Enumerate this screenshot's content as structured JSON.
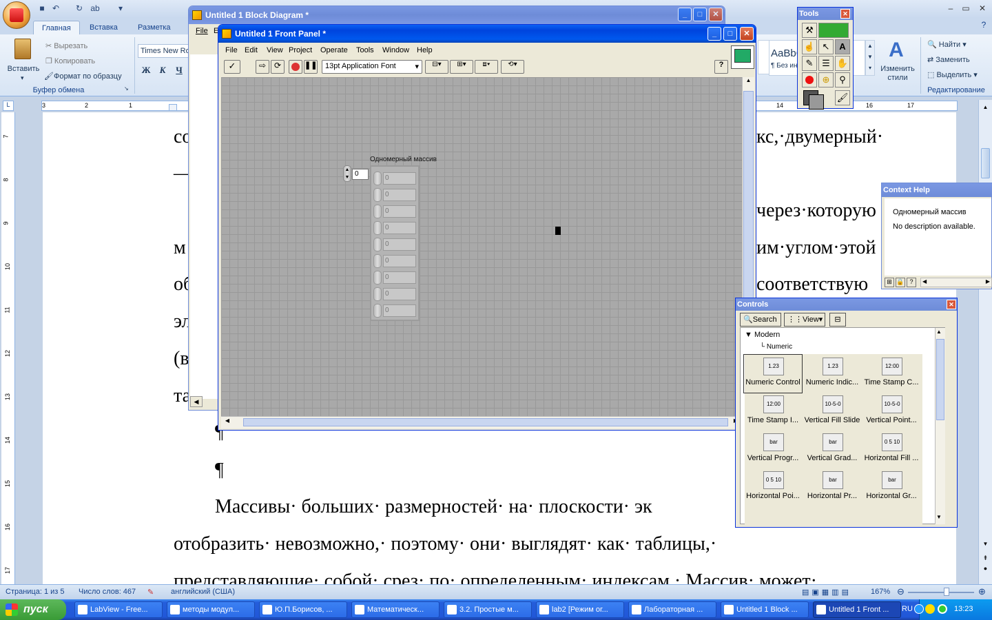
{
  "word": {
    "ribbon_tabs": [
      "Главная",
      "Вставка",
      "Разметка стра"
    ],
    "clipboard": {
      "paste": "Вставить",
      "cut": "Вырезать",
      "copy": "Копировать",
      "format_painter": "Формат по образцу",
      "group_label": "Буфер обмена"
    },
    "font_name": "Times New Ro",
    "bold": "Ж",
    "italic": "К",
    "underline": "Ч",
    "styles": {
      "sample": "AaBbC",
      "normal_label": "¶ Без ин",
      "change_styles": "Изменить стили"
    },
    "editing": {
      "find": "Найти",
      "replace": "Заменить",
      "select": "Выделить",
      "group_label": "Редактирование"
    },
    "ruler_left": [
      "3",
      "2",
      "1",
      "1"
    ],
    "ruler_right": [
      "14",
      "16",
      "17"
    ],
    "vruler": [
      "7",
      "8",
      "9",
      "10",
      "11",
      "12",
      "13",
      "14",
      "15",
      "16",
      "17"
    ],
    "doc_lines": [
      {
        "text": "со"
      },
      {
        "text": "кс,·двумерный·"
      },
      {
        "text": "—·"
      },
      {
        "text": "через·которую"
      },
      {
        "text": "м"
      },
      {
        "text": "им·углом·этой"
      },
      {
        "text": "об"
      },
      {
        "text": "соответствую"
      },
      {
        "text": "эл"
      },
      {
        "text": "(в"
      },
      {
        "text": "та"
      },
      {
        "text": "¶"
      },
      {
        "text": "¶"
      },
      {
        "text": "Массивы· больших· размерностей· на· плоскости· эк"
      },
      {
        "text": "отобразить·     невозможно,·     поэтому·     они·     выглядят·     как·     таблицы,·"
      },
      {
        "text": "представляющие· собой· срез· по· определенным· индексам.· Массив· может·"
      }
    ],
    "status": {
      "page": "Страница: 1 из 5",
      "words": "Число слов: 467",
      "language": "английский (США)",
      "zoom": "167%"
    }
  },
  "taskbar": {
    "start": "пуск",
    "items": [
      "LabView - Free...",
      "методы модул...",
      "Ю.П.Борисов, ...",
      "Математическ...",
      "3.2. Простые м...",
      "lab2 [Режим ог...",
      "Лабораторная ...",
      "Untitled 1 Block ...",
      "Untitled 1 Front ..."
    ],
    "lang": "RU",
    "clock": "13:23"
  },
  "block_diagram": {
    "title": "Untitled 1 Block Diagram *",
    "menu_first": "File",
    "menu_second": "E"
  },
  "front_panel": {
    "title": "Untitled 1 Front Panel *",
    "menu": [
      "File",
      "Edit",
      "View",
      "Project",
      "Operate",
      "Tools",
      "Window",
      "Help"
    ],
    "font_selector": "13pt Application Font",
    "array_label": "Одномерный массив",
    "index_value": "0",
    "elements": [
      "0",
      "0",
      "0",
      "0",
      "0",
      "0",
      "0",
      "0",
      "0"
    ]
  },
  "tools_palette": {
    "title": "Tools"
  },
  "context_help": {
    "title": "Context Help",
    "name": "Одномерный массив",
    "description": "No description available."
  },
  "controls_palette": {
    "title": "Controls",
    "search": "Search",
    "view": "View",
    "tree_root": "Modern",
    "tree_child": "Numeric",
    "items": [
      {
        "label": "Numeric Control",
        "icon": "1.23"
      },
      {
        "label": "Numeric Indic...",
        "icon": "1.23"
      },
      {
        "label": "Time Stamp C...",
        "icon": "12:00"
      },
      {
        "label": "Time Stamp I...",
        "icon": "12:00"
      },
      {
        "label": "Vertical Fill Slide",
        "icon": "10-5-0"
      },
      {
        "label": "Vertical Point...",
        "icon": "10-5-0"
      },
      {
        "label": "Vertical Progr...",
        "icon": "bar"
      },
      {
        "label": "Vertical Grad...",
        "icon": "bar"
      },
      {
        "label": "Horizontal Fill ...",
        "icon": "0 5 10"
      },
      {
        "label": "Horizontal Poi...",
        "icon": "0 5 10"
      },
      {
        "label": "Horizontal Pr...",
        "icon": "bar"
      },
      {
        "label": "Horizontal Gr...",
        "icon": "bar"
      }
    ]
  }
}
